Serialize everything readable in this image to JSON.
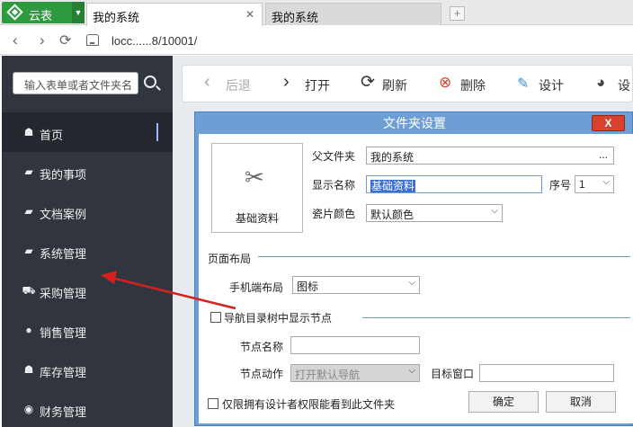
{
  "browser": {
    "app_name": "云表",
    "tabs": [
      {
        "title": "我的系统",
        "active": true
      },
      {
        "title": "我的系统",
        "active": false
      }
    ],
    "address": "locc......8/10001/"
  },
  "sidebar": {
    "search_placeholder": "输入表单或者文件夹名",
    "items": [
      {
        "label": "首页",
        "icon": "home-icon",
        "active": true
      },
      {
        "label": "我的事项",
        "icon": "folder-icon"
      },
      {
        "label": "文档案例",
        "icon": "folder-icon"
      },
      {
        "label": "系统管理",
        "icon": "folder-icon"
      },
      {
        "label": "采购管理",
        "icon": "cart-icon"
      },
      {
        "label": "销售管理",
        "icon": "user-icon"
      },
      {
        "label": "库存管理",
        "icon": "home-icon"
      },
      {
        "label": "财务管理",
        "icon": "money-icon"
      }
    ]
  },
  "toolbar": {
    "back": "后退",
    "open": "打开",
    "refresh": "刷新",
    "delete": "删除",
    "design": "设计",
    "design2": "设"
  },
  "dialog": {
    "title": "文件夹设置",
    "close": "X",
    "icon_caption": "基础资料",
    "parent_folder_label": "父文件夹",
    "parent_folder_value": "我的系统",
    "parent_folder_more": "...",
    "display_name_label": "显示名称",
    "display_name_value": "基础资料",
    "seq_label": "序号",
    "seq_value": "1",
    "tile_color_label": "瓷片颜色",
    "tile_color_value": "默认颜色",
    "page_layout_label": "页面布局",
    "mobile_layout_label": "手机端布局",
    "mobile_layout_value": "图标",
    "show_in_tree_label": "导航目录树中显示节点",
    "node_name_label": "节点名称",
    "node_name_value": "",
    "node_action_label": "节点动作",
    "node_action_value": "打开默认导航",
    "target_window_label": "目标窗口",
    "target_window_value": "",
    "designer_only_label": "仅限拥有设计者权限能看到此文件夹",
    "ok": "确定",
    "cancel": "取消"
  },
  "colors": {
    "app_green": "#2e9a3f",
    "sidebar_bg": "#31363e",
    "dialog_frame": "#6e9fd4",
    "close_red": "#d9412f",
    "annotation_red": "#d61f1f"
  }
}
